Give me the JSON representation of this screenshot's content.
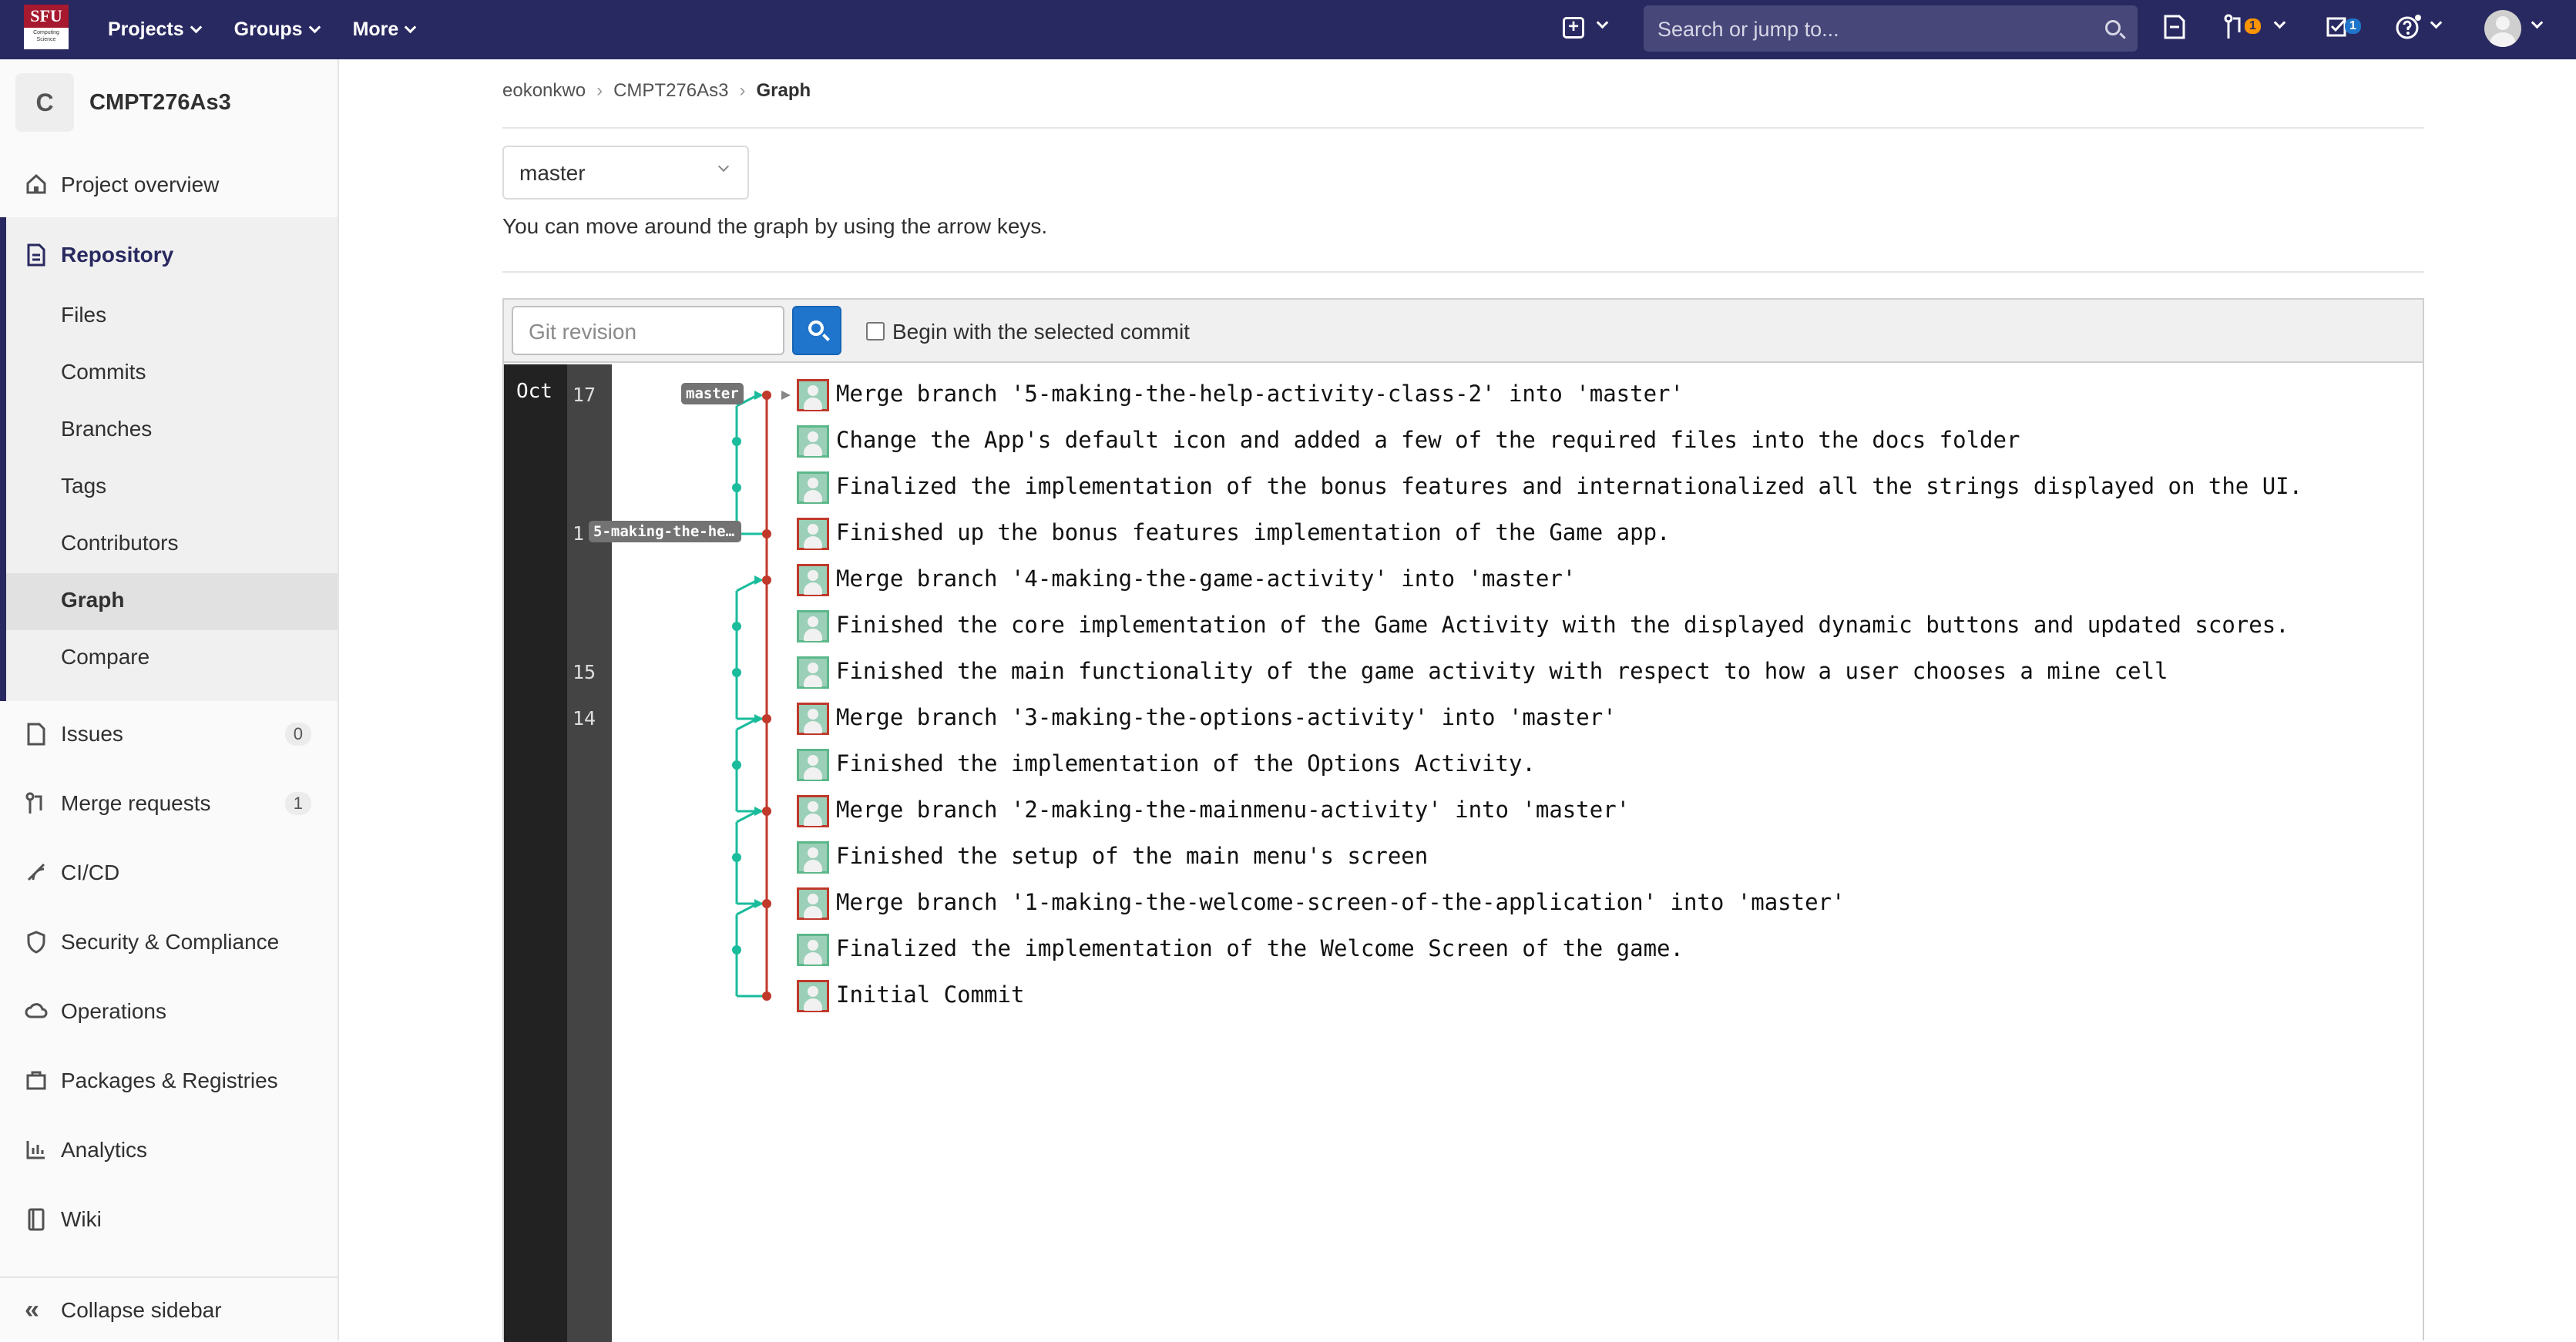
{
  "navbar": {
    "logo_text": "SFU",
    "logo_sub": "Computing Science",
    "menu": [
      "Projects",
      "Groups",
      "More"
    ],
    "search_placeholder": "Search or jump to...",
    "merge_requests_badge": "1",
    "todos_badge": "1"
  },
  "sidebar": {
    "project_initial": "C",
    "project_name": "CMPT276As3",
    "items": {
      "overview": "Project overview",
      "repository": "Repository",
      "issues": "Issues",
      "issues_count": "0",
      "merge_requests": "Merge requests",
      "merge_requests_count": "1",
      "cicd": "CI/CD",
      "security": "Security & Compliance",
      "operations": "Operations",
      "packages": "Packages & Registries",
      "analytics": "Analytics",
      "wiki": "Wiki"
    },
    "repo_sub": [
      "Files",
      "Commits",
      "Branches",
      "Tags",
      "Contributors",
      "Graph",
      "Compare"
    ],
    "active_sub": "Graph",
    "collapse": "Collapse sidebar"
  },
  "breadcrumb": [
    "eokonkwo",
    "CMPT276As3",
    "Graph"
  ],
  "branch_select": "master",
  "hint": "You can move around the graph by using the arrow keys.",
  "graph_tools": {
    "revision_placeholder": "Git revision",
    "begin_label": "Begin with the selected commit"
  },
  "graph": {
    "month": "Oct",
    "days": [
      {
        "label": "17",
        "row": 0
      },
      {
        "label": "1",
        "row": 3
      },
      {
        "label": "15",
        "row": 6
      },
      {
        "label": "14",
        "row": 7
      }
    ],
    "tags": {
      "master": "master",
      "branch": "5-making-the-he…"
    },
    "commits": [
      {
        "msg": "Merge branch '5-making-the-help-activity-class-2' into 'master'",
        "lane": "main"
      },
      {
        "msg": "Change the App's default icon and added a few of the required files into the docs folder",
        "lane": "side"
      },
      {
        "msg": "Finalized the implementation of the bonus features and internationalized all the strings displayed on the UI.",
        "lane": "side"
      },
      {
        "msg": "Finished up the bonus features implementation of the Game app.",
        "lane": "main"
      },
      {
        "msg": "Merge branch '4-making-the-game-activity' into 'master'",
        "lane": "main"
      },
      {
        "msg": "Finished the core implementation of the Game Activity with the displayed dynamic buttons and updated scores.",
        "lane": "side"
      },
      {
        "msg": "Finished the main functionality of the game activity with respect to how a user chooses a mine cell",
        "lane": "side"
      },
      {
        "msg": "Merge branch '3-making-the-options-activity' into 'master'",
        "lane": "main"
      },
      {
        "msg": "Finished the implementation of the Options Activity.",
        "lane": "side"
      },
      {
        "msg": "Merge branch '2-making-the-mainmenu-activity' into 'master'",
        "lane": "main"
      },
      {
        "msg": "Finished the setup of the main menu's screen",
        "lane": "side"
      },
      {
        "msg": "Merge branch '1-making-the-welcome-screen-of-the-application' into 'master'",
        "lane": "main"
      },
      {
        "msg": "Finalized the implementation of the Welcome Screen of the game.",
        "lane": "side"
      },
      {
        "msg": "Initial Commit",
        "lane": "main"
      }
    ],
    "colors": {
      "main": "#c0392b",
      "side": "#1abc9c"
    }
  }
}
